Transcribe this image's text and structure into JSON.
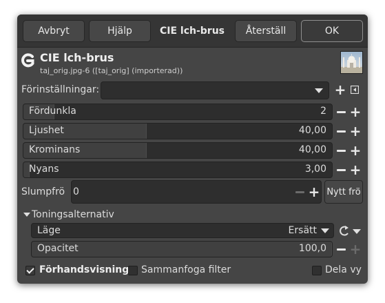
{
  "header": {
    "cancel_label": "Avbryt",
    "help_label": "Hjälp",
    "title": "CIE lch-brus",
    "reset_label": "Återställ",
    "ok_label": "OK"
  },
  "filter": {
    "name": "CIE lch-brus",
    "source": "taj_orig.jpg-6 ([taj_orig] (importerad))"
  },
  "presets": {
    "label": "Förinställningar:",
    "value": ""
  },
  "sliders": [
    {
      "label": "Fördunkla",
      "value": "2",
      "fraction": 0.1
    },
    {
      "label": "Ljushet",
      "value": "40,00",
      "fraction": 0.4
    },
    {
      "label": "Krominans",
      "value": "40,00",
      "fraction": 0.4
    },
    {
      "label": "Nyans",
      "value": "3,00",
      "fraction": 0.02
    }
  ],
  "seed": {
    "label": "Slumpfrö",
    "value": "0",
    "new_label": "Nytt frö"
  },
  "blending": {
    "section_label": "Toningsalternativ",
    "mode_label": "Läge",
    "mode_value": "Ersätt",
    "opacity_label": "Opacitet",
    "opacity_value": "100,0",
    "opacity_fraction": 1.0
  },
  "footer": {
    "preview_label": "Förhandsvisning",
    "preview_checked": true,
    "merge_label": "Sammanfoga filter",
    "merge_checked": false,
    "split_label": "Dela vy",
    "split_checked": false
  }
}
